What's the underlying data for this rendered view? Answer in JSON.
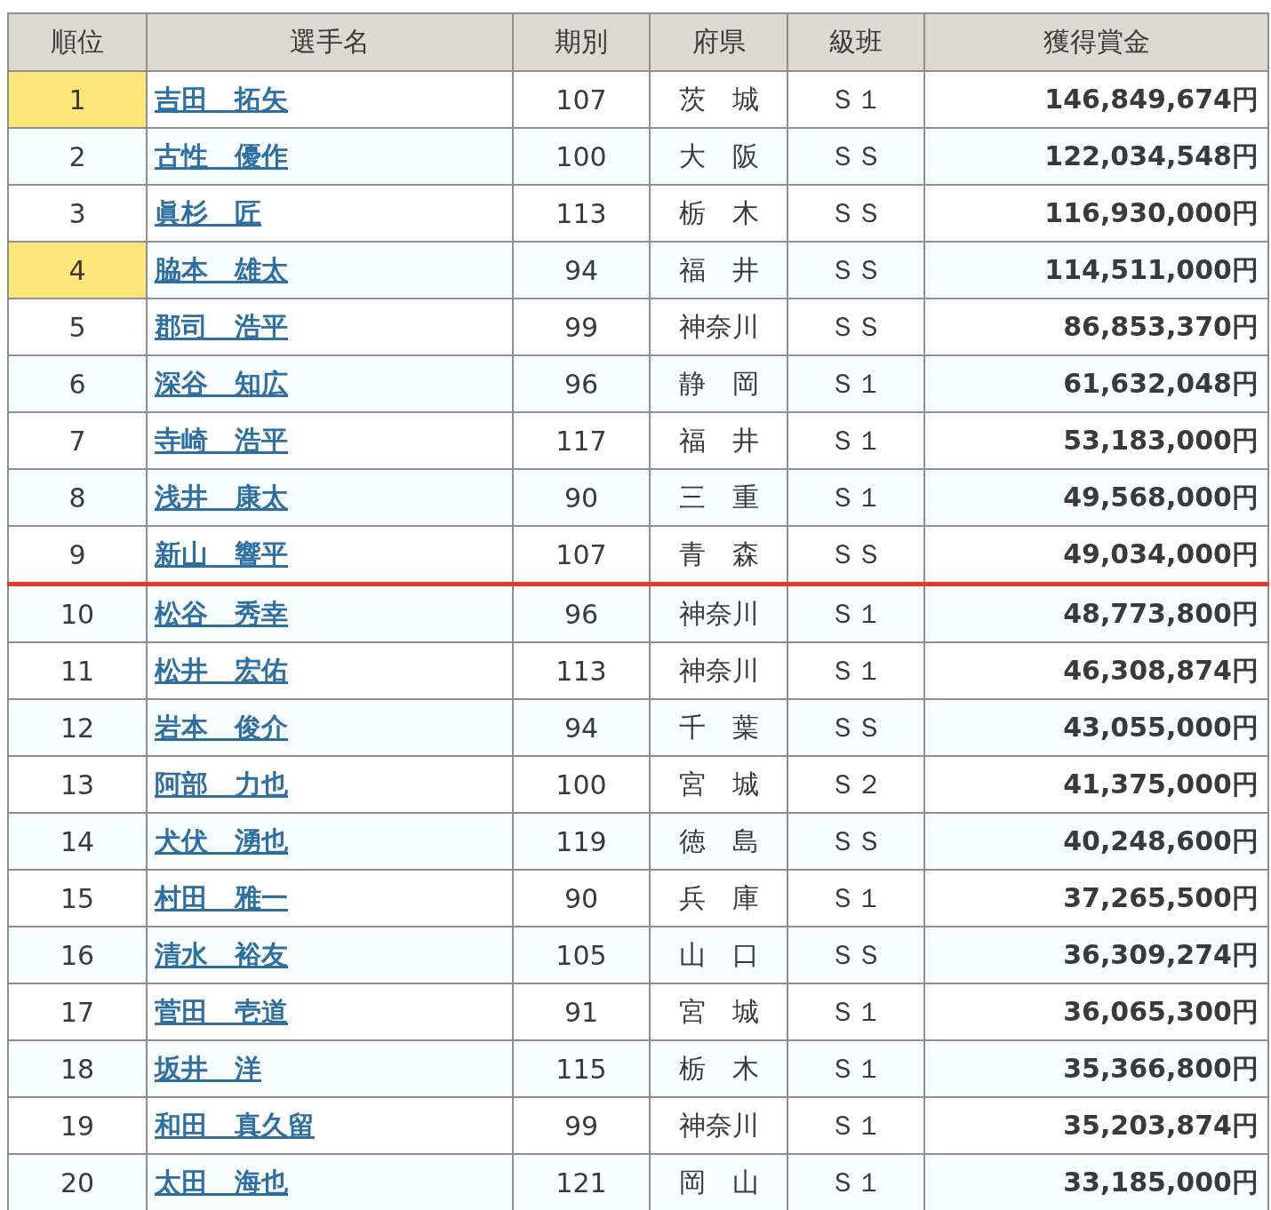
{
  "table": {
    "columns": [
      "順位",
      "選手名",
      "期別",
      "府県",
      "級班",
      "獲得賞金"
    ],
    "rows": [
      {
        "rank": "1",
        "name": "吉田　拓矢",
        "term": "107",
        "prefecture": "茨　城",
        "class": "Ｓ１",
        "prize": "146,849,674円",
        "highlighted": true,
        "cutoff": false
      },
      {
        "rank": "2",
        "name": "古性　優作",
        "term": "100",
        "prefecture": "大　阪",
        "class": "ＳＳ",
        "prize": "122,034,548円",
        "highlighted": false,
        "cutoff": false
      },
      {
        "rank": "3",
        "name": "眞杉　匠",
        "term": "113",
        "prefecture": "栃　木",
        "class": "ＳＳ",
        "prize": "116,930,000円",
        "highlighted": false,
        "cutoff": false
      },
      {
        "rank": "4",
        "name": "脇本　雄太",
        "term": "94",
        "prefecture": "福　井",
        "class": "ＳＳ",
        "prize": "114,511,000円",
        "highlighted": true,
        "cutoff": false
      },
      {
        "rank": "5",
        "name": "郡司　浩平",
        "term": "99",
        "prefecture": "神奈川",
        "class": "ＳＳ",
        "prize": "86,853,370円",
        "highlighted": false,
        "cutoff": false
      },
      {
        "rank": "6",
        "name": "深谷　知広",
        "term": "96",
        "prefecture": "静　岡",
        "class": "Ｓ１",
        "prize": "61,632,048円",
        "highlighted": false,
        "cutoff": false
      },
      {
        "rank": "7",
        "name": "寺崎　浩平",
        "term": "117",
        "prefecture": "福　井",
        "class": "Ｓ１",
        "prize": "53,183,000円",
        "highlighted": false,
        "cutoff": false
      },
      {
        "rank": "8",
        "name": "浅井　康太",
        "term": "90",
        "prefecture": "三　重",
        "class": "Ｓ１",
        "prize": "49,568,000円",
        "highlighted": false,
        "cutoff": false
      },
      {
        "rank": "9",
        "name": "新山　響平",
        "term": "107",
        "prefecture": "青　森",
        "class": "ＳＳ",
        "prize": "49,034,000円",
        "highlighted": false,
        "cutoff": true
      },
      {
        "rank": "10",
        "name": "松谷　秀幸",
        "term": "96",
        "prefecture": "神奈川",
        "class": "Ｓ１",
        "prize": "48,773,800円",
        "highlighted": false,
        "cutoff": false
      },
      {
        "rank": "11",
        "name": "松井　宏佑",
        "term": "113",
        "prefecture": "神奈川",
        "class": "Ｓ１",
        "prize": "46,308,874円",
        "highlighted": false,
        "cutoff": false
      },
      {
        "rank": "12",
        "name": "岩本　俊介",
        "term": "94",
        "prefecture": "千　葉",
        "class": "ＳＳ",
        "prize": "43,055,000円",
        "highlighted": false,
        "cutoff": false
      },
      {
        "rank": "13",
        "name": "阿部　力也",
        "term": "100",
        "prefecture": "宮　城",
        "class": "Ｓ２",
        "prize": "41,375,000円",
        "highlighted": false,
        "cutoff": false
      },
      {
        "rank": "14",
        "name": "犬伏　湧也",
        "term": "119",
        "prefecture": "徳　島",
        "class": "ＳＳ",
        "prize": "40,248,600円",
        "highlighted": false,
        "cutoff": false
      },
      {
        "rank": "15",
        "name": "村田　雅一",
        "term": "90",
        "prefecture": "兵　庫",
        "class": "Ｓ１",
        "prize": "37,265,500円",
        "highlighted": false,
        "cutoff": false
      },
      {
        "rank": "16",
        "name": "清水　裕友",
        "term": "105",
        "prefecture": "山　口",
        "class": "ＳＳ",
        "prize": "36,309,274円",
        "highlighted": false,
        "cutoff": false
      },
      {
        "rank": "17",
        "name": "菅田　壱道",
        "term": "91",
        "prefecture": "宮　城",
        "class": "Ｓ１",
        "prize": "36,065,300円",
        "highlighted": false,
        "cutoff": false
      },
      {
        "rank": "18",
        "name": "坂井　洋",
        "term": "115",
        "prefecture": "栃　木",
        "class": "Ｓ１",
        "prize": "35,366,800円",
        "highlighted": false,
        "cutoff": false
      },
      {
        "rank": "19",
        "name": "和田　真久留",
        "term": "99",
        "prefecture": "神奈川",
        "class": "Ｓ１",
        "prize": "35,203,874円",
        "highlighted": false,
        "cutoff": false
      },
      {
        "rank": "20",
        "name": "太田　海也",
        "term": "121",
        "prefecture": "岡　山",
        "class": "Ｓ１",
        "prize": "33,185,000円",
        "highlighted": false,
        "cutoff": false
      }
    ]
  }
}
